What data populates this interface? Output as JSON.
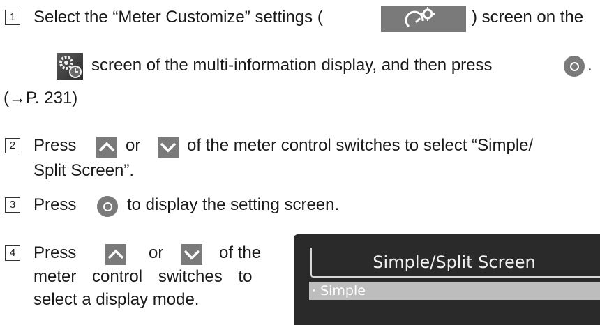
{
  "steps": [
    {
      "number": "1",
      "line1_a": "Select the “Meter Customize” settings (",
      "line1_b": ") screen on the",
      "line2": "screen of the multi-information display, and then press",
      "line2_end": ".",
      "line3": "(→P. 231)"
    },
    {
      "number": "2",
      "line1_a": "Press",
      "line1_b": "or",
      "line1_c": "of the meter control switches to select “Simple/",
      "line2": "Split Screen”."
    },
    {
      "number": "3",
      "line1_a": "Press",
      "line1_b": "to display the setting screen."
    },
    {
      "number": "4",
      "line1_a": "Press",
      "line1_b": "or",
      "line1_c": "of the",
      "line2": "meter control switches to",
      "line3": "select a display mode."
    }
  ],
  "display_panel": {
    "title": "Simple/Split Screen",
    "item": "· Simple",
    "bg_color": "#2a2a2a",
    "highlight_color": "#bdbdbd"
  },
  "icons": {
    "meter": "meter-customize-icon",
    "settings": "settings-clock-icon",
    "up": "chevron-up-icon",
    "down": "chevron-down-icon",
    "ok": "ok-button-icon"
  }
}
